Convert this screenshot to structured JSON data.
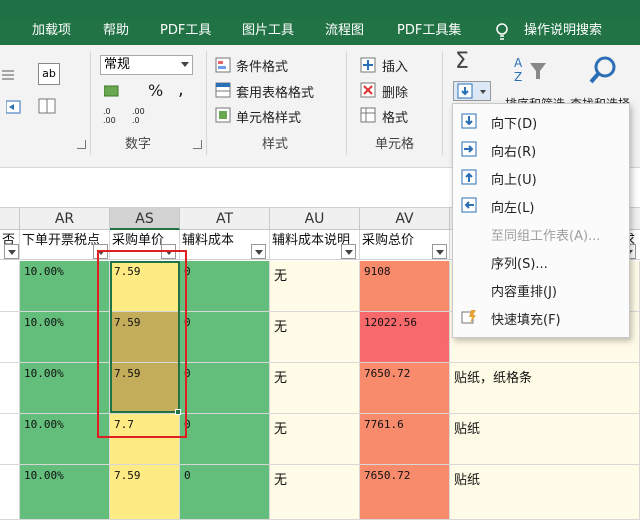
{
  "menubar": {
    "items": [
      "加载项",
      "帮助",
      "PDF工具",
      "图片工具",
      "流程图",
      "PDF工具集",
      "操作说明搜索"
    ],
    "tell_me_icon": "lightbulb-icon"
  },
  "ribbon": {
    "number_format": "常规",
    "percent_symbol": "%",
    "comma_symbol": ",",
    "conditional_format": "条件格式",
    "table_format": "套用表格格式",
    "cell_style": "单元格样式",
    "insert": "插入",
    "delete": "删除",
    "format": "格式",
    "sort_filter": "排序和筛选",
    "find_select": "查找和选择",
    "group_number": "数字",
    "group_style": "样式",
    "group_cells": "单元格",
    "decimal_increase": ".0\n.00",
    "decimal_decrease": ".00\n→.0"
  },
  "columns": [
    {
      "letter": "AR",
      "field": "下单开票税点"
    },
    {
      "letter": "AS",
      "field": "采购单价"
    },
    {
      "letter": "AT",
      "field": "辅料成本"
    },
    {
      "letter": "AU",
      "field": "辅料成本说明"
    },
    {
      "letter": "AV",
      "field": "采购总价"
    }
  ],
  "left_partial_field": "否",
  "right_partial_field": "求",
  "rows": [
    {
      "ar": "10.00%",
      "as": "7.59",
      "at": "0",
      "au": "无",
      "av": "9108",
      "aw": "!"
    },
    {
      "ar": "10.00%",
      "as": "7.59",
      "at": "0",
      "au": "无",
      "av": "12022.56",
      "aw": "!"
    },
    {
      "ar": "10.00%",
      "as": "7.59",
      "at": "0",
      "au": "无",
      "av": "7650.72",
      "aw": "贴纸，纸格条"
    },
    {
      "ar": "10.00%",
      "as": "7.7",
      "at": "0",
      "au": "无",
      "av": "7761.6",
      "aw": "贴纸"
    },
    {
      "ar": "10.00%",
      "as": "7.59",
      "at": "0",
      "au": "无",
      "av": "7650.72",
      "aw": "贴纸"
    }
  ],
  "dropdown": {
    "items": [
      {
        "label": "向下(D)",
        "icon": "fill-down-icon",
        "enabled": true
      },
      {
        "label": "向右(R)",
        "icon": "fill-right-icon",
        "enabled": true
      },
      {
        "label": "向上(U)",
        "icon": "fill-up-icon",
        "enabled": true
      },
      {
        "label": "向左(L)",
        "icon": "fill-left-icon",
        "enabled": true
      },
      {
        "label": "至同组工作表(A)...",
        "icon": "",
        "enabled": false
      },
      {
        "label": "序列(S)...",
        "icon": "",
        "enabled": true
      },
      {
        "label": "内容重排(J)",
        "icon": "",
        "enabled": true
      },
      {
        "label": "快速填充(F)",
        "icon": "flash-fill-icon",
        "enabled": true
      }
    ]
  },
  "colors": {
    "green_cell": "#63be7b",
    "yellow_cell": "#ffeb84",
    "selected_cell": "#c4ad5a",
    "av_red": "#f8696b",
    "av_orange": "#f98b6d",
    "annotation_red": "#e02020"
  }
}
